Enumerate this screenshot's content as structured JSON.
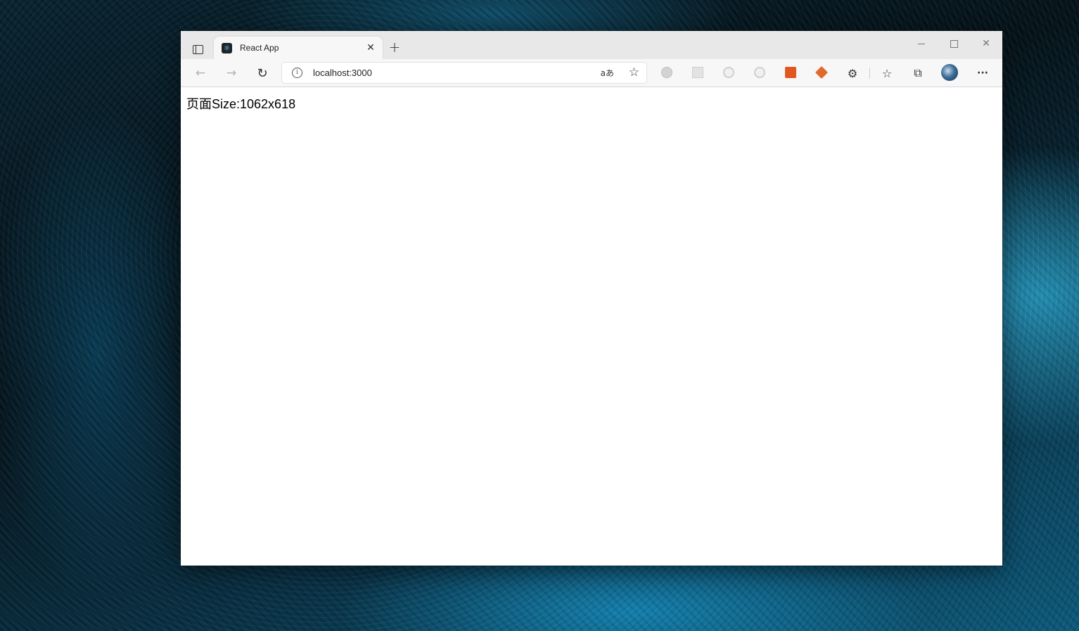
{
  "tab": {
    "title": "React App",
    "favicon": "react-icon",
    "close_glyph": "✕"
  },
  "tabbar": {
    "new_tab_glyph": "+"
  },
  "window_controls": {
    "close_glyph": "✕"
  },
  "toolbar": {
    "back_glyph": "←",
    "forward_glyph": "→",
    "refresh_glyph": "↻",
    "address": "localhost:3000",
    "read_aloud_glyph": "aあ",
    "favorite_add_glyph": "☆",
    "extensions_glyph": "⚙",
    "favorites_glyph": "☆",
    "collections_glyph": "⧉",
    "menu_glyph": "···"
  },
  "page": {
    "size_text": "页面Size:1062x618"
  },
  "colors": {
    "tabbar_bg": "#e8e8e8",
    "toolbar_bg": "#f7f7f7",
    "page_bg": "#ffffff"
  }
}
